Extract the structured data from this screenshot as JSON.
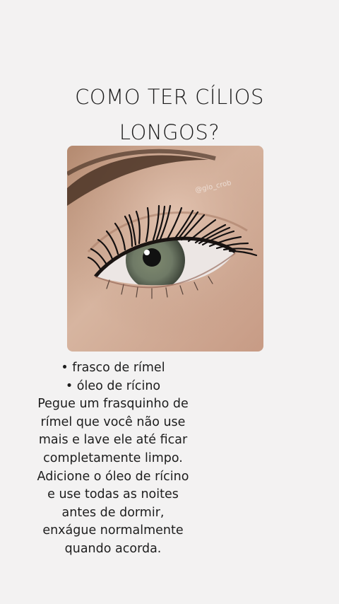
{
  "title": {
    "line1": "COMO TER CÍLIOS",
    "line2": "LONGOS?"
  },
  "photo": {
    "watermark": "@glo_crob"
  },
  "content": {
    "bullets": [
      "• frasco de rímel",
      "• óleo de rícino"
    ],
    "lines": [
      "Pegue um frasquinho de",
      "rímel que você não use",
      "mais e lave ele até ficar",
      "completamente limpo.",
      "Adicione o óleo de rícino",
      "e use todas as noites",
      "antes de dormir,",
      "enxágue normalmente",
      "quando acorda."
    ]
  }
}
